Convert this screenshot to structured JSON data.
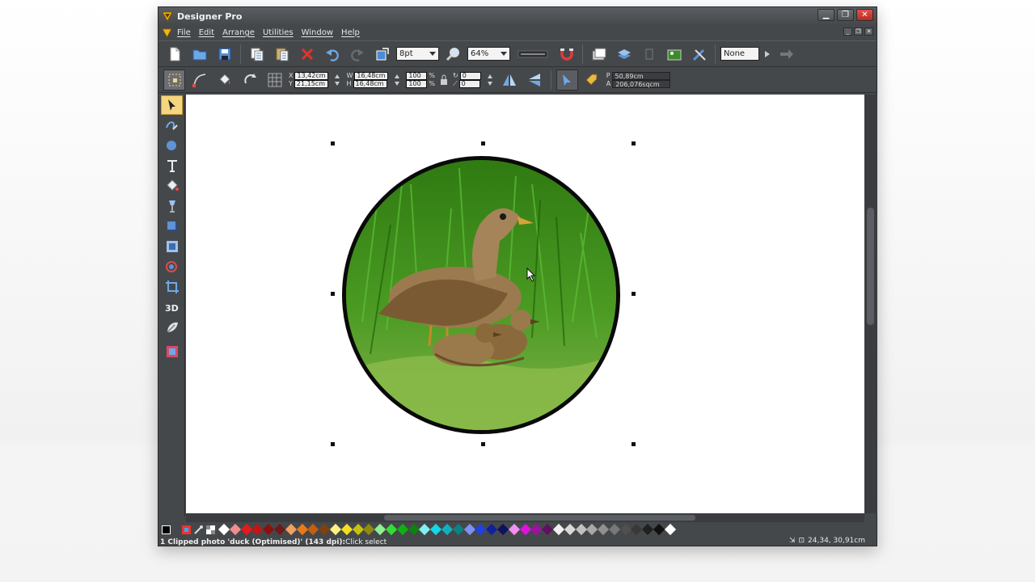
{
  "app": {
    "title": "Designer Pro"
  },
  "menu": {
    "items": [
      "File",
      "Edit",
      "Arrange",
      "Utilities",
      "Window",
      "Help"
    ]
  },
  "toolbar1": {
    "line_width_value": "8pt",
    "zoom_value": "64%",
    "none_value": "None"
  },
  "toolbar2": {
    "x_label": "X",
    "x_value": "13,42cm",
    "y_label": "Y",
    "y_value": "21,15cm",
    "w_label": "W",
    "w_value": "16,48cm",
    "h_label": "H",
    "h_value": "16,48cm",
    "scale_w": "100",
    "scale_h": "100",
    "pct_label": "%",
    "angle_value": "0",
    "skew_value": "0",
    "p_label": "P",
    "p_value": "50,89cm",
    "a_label": "A",
    "a_value": "206,076sqcm"
  },
  "status": {
    "message": "1 Clipped photo 'duck (Optimised)' (143 dpi): ",
    "action": "Click select",
    "coords": "24,34, 30,91cm"
  },
  "colors": {
    "window_bg": "#45484b",
    "selection_accent": "#f5d580",
    "close_red": "#c9372e"
  },
  "palette": [
    "#ffffff",
    "#f28c8c",
    "#e31b1b",
    "#c41414",
    "#8b1010",
    "#6e1a1a",
    "#f0a060",
    "#e87a1a",
    "#c06010",
    "#804010",
    "#fff280",
    "#f0e020",
    "#c8c010",
    "#908a10",
    "#90f090",
    "#30e030",
    "#10b010",
    "#108010",
    "#80f0f0",
    "#10d8e8",
    "#10b0c0",
    "#108080",
    "#8090f0",
    "#2040e0",
    "#1020a0",
    "#101060",
    "#f090f0",
    "#e010e0",
    "#a010a0",
    "#601060",
    "#f0f0f0",
    "#d8d8d8",
    "#c0c0c0",
    "#a8a8a8",
    "#909090",
    "#787878",
    "#505050",
    "#383838",
    "#202020",
    "#101010",
    "#ffffff"
  ]
}
